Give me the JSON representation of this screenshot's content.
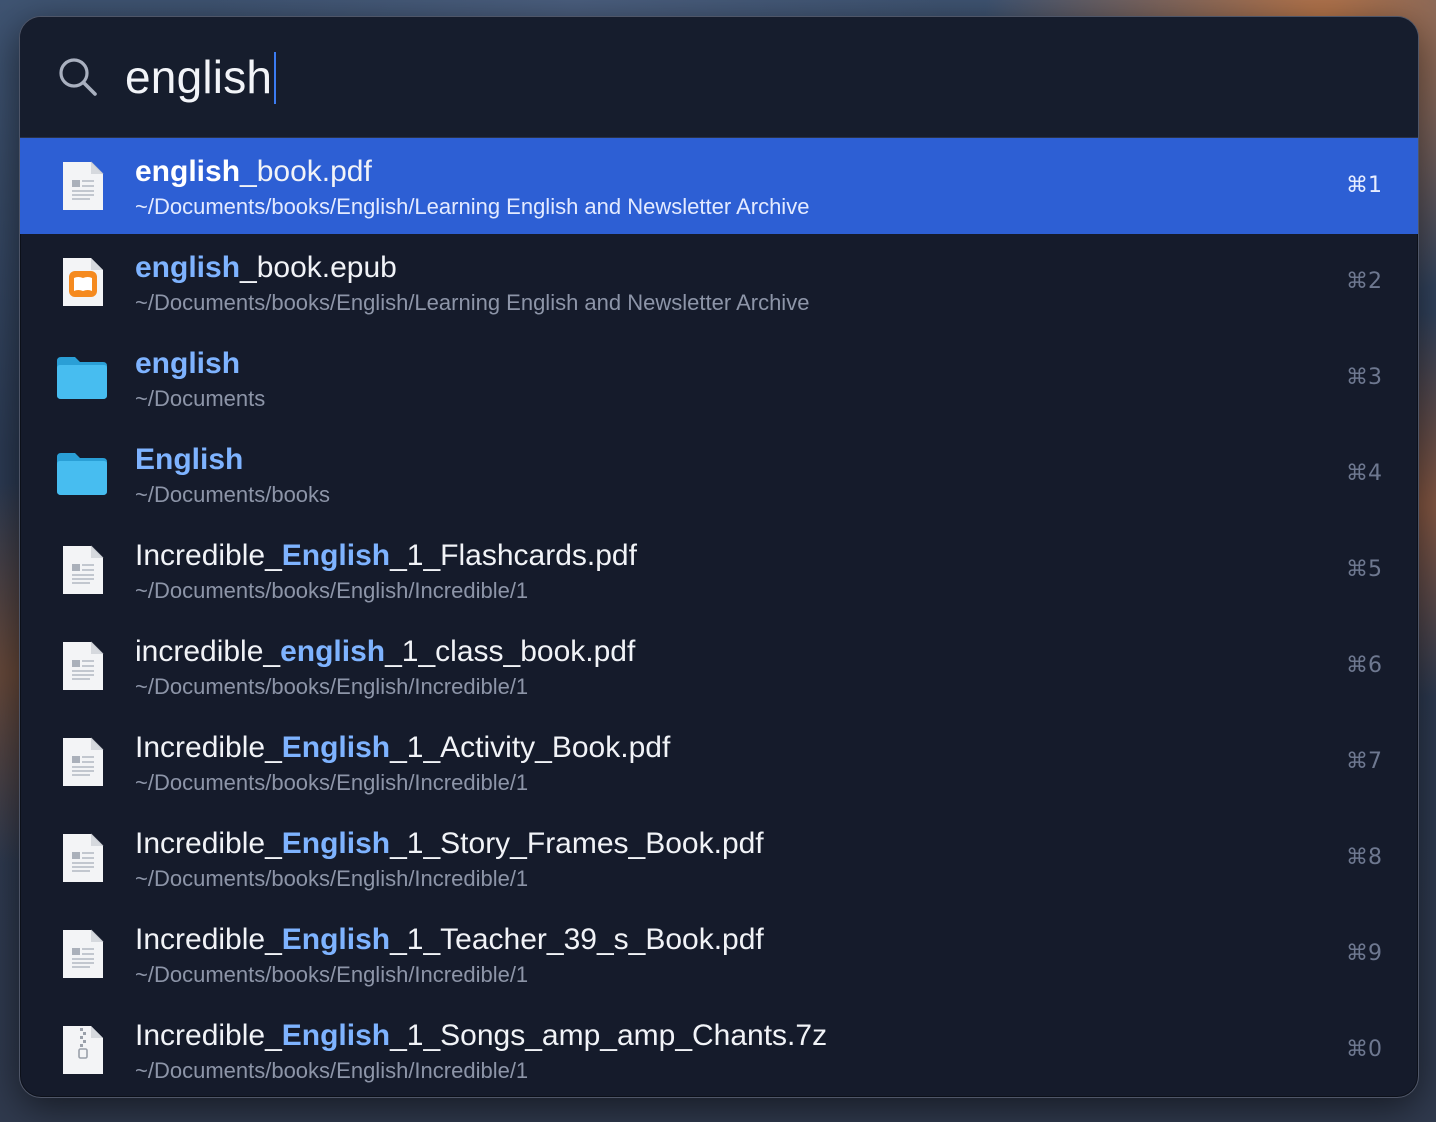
{
  "search": {
    "query": "english"
  },
  "results": [
    {
      "type": "pdf",
      "title_pre": "",
      "title_match": "english",
      "title_post": "_book.pdf",
      "path": "~/Documents/books/English/Learning English and Newsletter Archive",
      "shortcut": "⌘1",
      "selected": true
    },
    {
      "type": "epub",
      "title_pre": "",
      "title_match": "english",
      "title_post": "_book.epub",
      "path": "~/Documents/books/English/Learning English and Newsletter Archive",
      "shortcut": "⌘2",
      "selected": false
    },
    {
      "type": "folder",
      "title_pre": "",
      "title_match": "english",
      "title_post": "",
      "path": "~/Documents",
      "shortcut": "⌘3",
      "selected": false
    },
    {
      "type": "folder",
      "title_pre": "",
      "title_match": "English",
      "title_post": "",
      "path": "~/Documents/books",
      "shortcut": "⌘4",
      "selected": false
    },
    {
      "type": "pdf",
      "title_pre": "Incredible_",
      "title_match": "English",
      "title_post": "_1_Flashcards.pdf",
      "path": "~/Documents/books/English/Incredible/1",
      "shortcut": "⌘5",
      "selected": false
    },
    {
      "type": "pdf",
      "title_pre": "incredible_",
      "title_match": "english",
      "title_post": "_1_class_book.pdf",
      "path": "~/Documents/books/English/Incredible/1",
      "shortcut": "⌘6",
      "selected": false
    },
    {
      "type": "pdf",
      "title_pre": "Incredible_",
      "title_match": "English",
      "title_post": "_1_Activity_Book.pdf",
      "path": "~/Documents/books/English/Incredible/1",
      "shortcut": "⌘7",
      "selected": false
    },
    {
      "type": "pdf",
      "title_pre": "Incredible_",
      "title_match": "English",
      "title_post": "_1_Story_Frames_Book.pdf",
      "path": "~/Documents/books/English/Incredible/1",
      "shortcut": "⌘8",
      "selected": false
    },
    {
      "type": "pdf",
      "title_pre": "Incredible_",
      "title_match": "English",
      "title_post": "_1_Teacher_39_s_Book.pdf",
      "path": "~/Documents/books/English/Incredible/1",
      "shortcut": "⌘9",
      "selected": false
    },
    {
      "type": "archive",
      "title_pre": "Incredible_",
      "title_match": "English",
      "title_post": "_1_Songs_amp_amp_Chants.7z",
      "path": "~/Documents/books/English/Incredible/1",
      "shortcut": "⌘0",
      "selected": false
    }
  ],
  "icons": {
    "search": "magnifying-glass-icon",
    "pdf": "pdf-document-icon",
    "epub": "epub-book-icon",
    "folder": "folder-icon",
    "archive": "zip-archive-icon"
  },
  "colors": {
    "selection": "#2d5fd4",
    "highlight": "#7eb3ff",
    "panel_background": "#151b2b"
  }
}
